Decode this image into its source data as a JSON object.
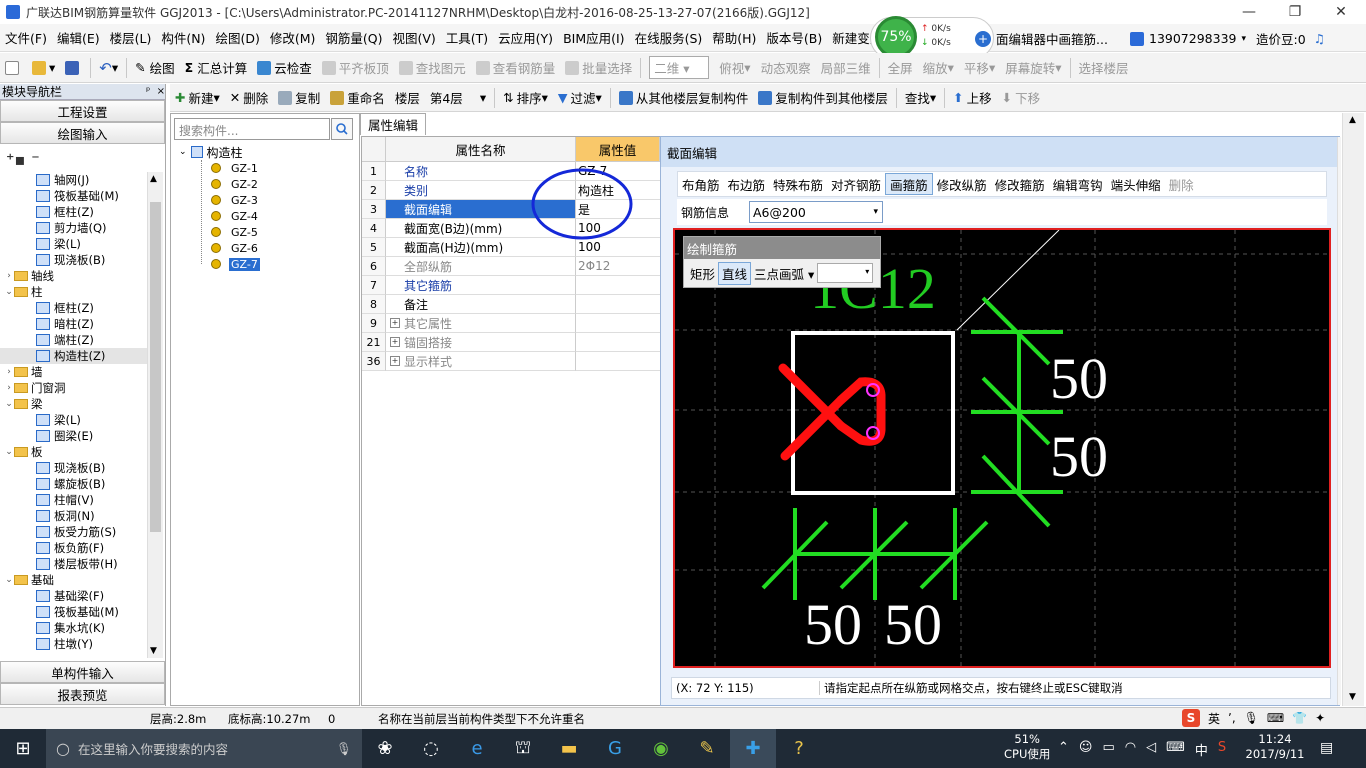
{
  "window": {
    "title": "广联达BIM钢筋算量软件 GGJ2013 - [C:\\Users\\Administrator.PC-20141127NRHM\\Desktop\\白龙村-2016-08-25-13-27-07(2166版).GGJ12]",
    "min": "—",
    "restore": "❐",
    "close": "✕"
  },
  "menu": {
    "items": [
      "文件(F)",
      "编辑(E)",
      "楼层(L)",
      "构件(N)",
      "绘图(D)",
      "修改(M)",
      "钢筋量(Q)",
      "视图(V)",
      "工具(T)",
      "云应用(Y)",
      "BIM应用(I)",
      "在线服务(S)",
      "帮助(H)",
      "版本号(B)"
    ],
    "new_change": "新建变更",
    "notice": "面编辑器中画箍筋...",
    "phone": "13907298339",
    "price_bean": "造价豆:0"
  },
  "speed": {
    "percent": "75%",
    "up": "0K/s",
    "down": "0K/s"
  },
  "toolbar": {
    "draw": "绘图",
    "sum": "汇总计算",
    "cloud_check": "云检查",
    "flat_board": "平齐板顶",
    "find_elem": "查找图元",
    "view_rebar": "查看钢筋量",
    "batch_select": "批量选择",
    "view_mode": "二维",
    "top_view": "俯视",
    "dynamic": "动态观察",
    "local3d": "局部三维",
    "fullscreen": "全屏",
    "zoom": "缩放",
    "pan": "平移",
    "rotate": "屏幕旋转",
    "select_floor": "选择楼层"
  },
  "toolbar2": {
    "new": "新建",
    "delete": "删除",
    "copy": "复制",
    "rename": "重命名",
    "floor_label": "楼层",
    "floor_value": "第4层",
    "sort": "排序",
    "filter": "过滤",
    "copy_from": "从其他楼层复制构件",
    "copy_to": "复制构件到其他楼层",
    "find": "查找",
    "up": "上移",
    "down": "下移"
  },
  "nav": {
    "header": "模块导航栏",
    "pin": "ᵖ",
    "close": "×",
    "project_settings": "工程设置",
    "drawing_input": "绘图输入",
    "single_input": "单构件输入",
    "report": "报表预览",
    "tree": [
      {
        "label": "轴网(J)",
        "level": 2,
        "type": "leaf"
      },
      {
        "label": "筏板基础(M)",
        "level": 2,
        "type": "leaf"
      },
      {
        "label": "框柱(Z)",
        "level": 2,
        "type": "leaf"
      },
      {
        "label": "剪力墙(Q)",
        "level": 2,
        "type": "leaf"
      },
      {
        "label": "梁(L)",
        "level": 2,
        "type": "leaf"
      },
      {
        "label": "现浇板(B)",
        "level": 2,
        "type": "leaf"
      },
      {
        "label": "轴线",
        "level": 1,
        "type": "folder",
        "toggle": "›"
      },
      {
        "label": "柱",
        "level": 1,
        "type": "folder",
        "toggle": "⌄"
      },
      {
        "label": "框柱(Z)",
        "level": 2,
        "type": "leaf"
      },
      {
        "label": "暗柱(Z)",
        "level": 2,
        "type": "leaf"
      },
      {
        "label": "端柱(Z)",
        "level": 2,
        "type": "leaf"
      },
      {
        "label": "构造柱(Z)",
        "level": 2,
        "type": "leaf",
        "selected": true
      },
      {
        "label": "墙",
        "level": 1,
        "type": "folder",
        "toggle": "›"
      },
      {
        "label": "门窗洞",
        "level": 1,
        "type": "folder",
        "toggle": "›"
      },
      {
        "label": "梁",
        "level": 1,
        "type": "folder",
        "toggle": "⌄"
      },
      {
        "label": "梁(L)",
        "level": 2,
        "type": "leaf"
      },
      {
        "label": "圈梁(E)",
        "level": 2,
        "type": "leaf"
      },
      {
        "label": "板",
        "level": 1,
        "type": "folder",
        "toggle": "⌄"
      },
      {
        "label": "现浇板(B)",
        "level": 2,
        "type": "leaf"
      },
      {
        "label": "螺旋板(B)",
        "level": 2,
        "type": "leaf"
      },
      {
        "label": "柱帽(V)",
        "level": 2,
        "type": "leaf"
      },
      {
        "label": "板洞(N)",
        "level": 2,
        "type": "leaf"
      },
      {
        "label": "板受力筋(S)",
        "level": 2,
        "type": "leaf"
      },
      {
        "label": "板负筋(F)",
        "level": 2,
        "type": "leaf"
      },
      {
        "label": "楼层板带(H)",
        "level": 2,
        "type": "leaf"
      },
      {
        "label": "基础",
        "level": 1,
        "type": "folder",
        "toggle": "⌄"
      },
      {
        "label": "基础梁(F)",
        "level": 2,
        "type": "leaf"
      },
      {
        "label": "筏板基础(M)",
        "level": 2,
        "type": "leaf"
      },
      {
        "label": "集水坑(K)",
        "level": 2,
        "type": "leaf"
      },
      {
        "label": "柱墩(Y)",
        "level": 2,
        "type": "leaf"
      }
    ]
  },
  "components": {
    "search_placeholder": "搜索构件...",
    "root": "构造柱",
    "items": [
      "GZ-1",
      "GZ-2",
      "GZ-3",
      "GZ-4",
      "GZ-5",
      "GZ-6",
      "GZ-7"
    ],
    "selected": "GZ-7"
  },
  "props": {
    "tab": "属性编辑",
    "col_name": "属性名称",
    "col_value": "属性值",
    "rows": [
      {
        "n": "1",
        "k": "名称",
        "v": "GZ-7",
        "style": "blue"
      },
      {
        "n": "2",
        "k": "类别",
        "v": "构造柱",
        "style": "blue"
      },
      {
        "n": "3",
        "k": "截面编辑",
        "v": "是",
        "style": "sel"
      },
      {
        "n": "4",
        "k": "截面宽(B边)(mm)",
        "v": "100",
        "style": ""
      },
      {
        "n": "5",
        "k": "截面高(H边)(mm)",
        "v": "100",
        "style": ""
      },
      {
        "n": "6",
        "k": "全部纵筋",
        "v": "2Φ12",
        "style": "gray"
      },
      {
        "n": "7",
        "k": "其它箍筋",
        "v": "",
        "style": "blue"
      },
      {
        "n": "8",
        "k": "备注",
        "v": "",
        "style": ""
      },
      {
        "n": "9",
        "k": "其它属性",
        "v": "",
        "style": "gray",
        "plus": true
      },
      {
        "n": "21",
        "k": "锚固搭接",
        "v": "",
        "style": "gray",
        "plus": true
      },
      {
        "n": "36",
        "k": "显示样式",
        "v": "",
        "style": "gray",
        "plus": true
      }
    ]
  },
  "section": {
    "title": "截面编辑",
    "tools": [
      "布角筋",
      "布边筋",
      "特殊布筋",
      "对齐钢筋",
      "画箍筋",
      "修改纵筋",
      "修改箍筋",
      "编辑弯钩",
      "端头伸缩",
      "删除"
    ],
    "active_tool": "画箍筋",
    "rebar_label": "钢筋信息",
    "rebar_value": "A6@200",
    "draw_panel": {
      "title": "绘制箍筋",
      "rect": "矩形",
      "line": "直线",
      "arc": "三点画弧"
    },
    "canvas_label": "1C12",
    "dims": [
      "50",
      "50",
      "50",
      "50"
    ],
    "coord": "(X: 72 Y: 115)",
    "hint": "请指定起点所在纵筋或网格交点，按右键终止或ESC键取消",
    "colors": {
      "frame": "#e02020",
      "rebar_text": "#22cc22",
      "stirrup": "#ff1010",
      "point": "#ff33ff"
    }
  },
  "status": {
    "floor_height": "层高:2.8m",
    "bottom_elev": "底标高:10.27m",
    "zero": "0",
    "message": "名称在当前层当前构件类型下不允许重名"
  },
  "taskbar": {
    "search": "在这里输入你要搜索的内容",
    "cpu": "51%",
    "cpu_label": "CPU使用",
    "ime": "中",
    "ime_lang": "英",
    "time": "11:24",
    "date": "2017/9/11"
  }
}
